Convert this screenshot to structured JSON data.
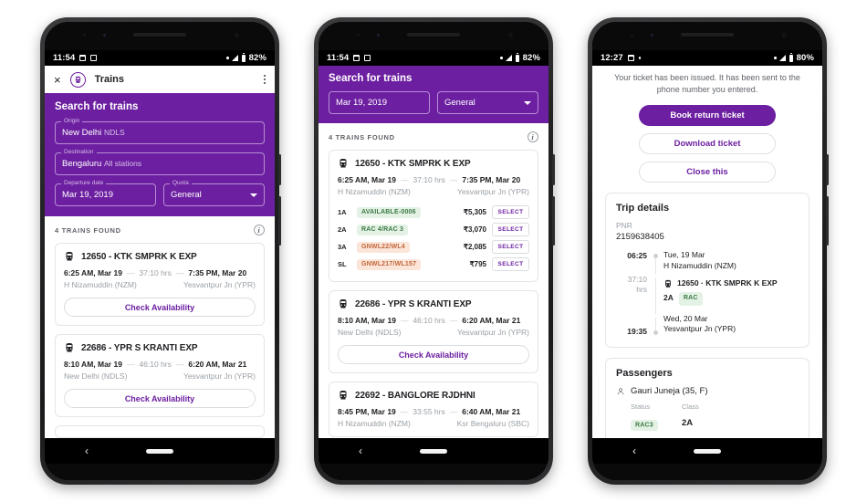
{
  "phone1": {
    "status_bar": {
      "time": "11:54",
      "battery": "82%"
    },
    "appbar": {
      "close_label": "×",
      "title": "Trains"
    },
    "search": {
      "heading": "Search for trains",
      "origin_label": "Origin",
      "origin_value": "New Delhi",
      "origin_sub": "NDLS",
      "destination_label": "Destination",
      "destination_value": "Bengaluru",
      "destination_sub": "All stations",
      "date_label": "Departure date",
      "date_value": "Mar 19, 2019",
      "quota_label": "Quota",
      "quota_value": "General"
    },
    "results_count": "4 TRAINS FOUND",
    "trains": [
      {
        "name": "12650 - KTK SMPRK K EXP",
        "depart": "6:25 AM, Mar 19",
        "duration": "37:10 hrs",
        "arrive": "7:35 PM, Mar 20",
        "from": "H Nizamuddin (NZM)",
        "to": "Yesvantpur Jn (YPR)",
        "cta": "Check Availability"
      },
      {
        "name": "22686 - YPR S KRANTI EXP",
        "depart": "8:10 AM, Mar 19",
        "duration": "46:10 hrs",
        "arrive": "6:20 AM, Mar 21",
        "from": "New Delhi (NDLS)",
        "to": "Yesvantpur Jn (YPR)",
        "cta": "Check Availability"
      }
    ]
  },
  "phone2": {
    "status_bar": {
      "time": "11:54",
      "battery": "82%"
    },
    "search": {
      "heading": "Search for trains",
      "date_value": "Mar 19, 2019",
      "quota_value": "General"
    },
    "results_count": "4 TRAINS FOUND",
    "train_expanded": {
      "name": "12650 - KTK SMPRK K EXP",
      "depart": "6:25 AM, Mar 19",
      "duration": "37:10 hrs",
      "arrive": "7:35 PM, Mar 20",
      "from": "H Nizamuddin (NZM)",
      "to": "Yesvantpur Jn (YPR)",
      "select_label": "SELECT",
      "fares": [
        {
          "class": "1A",
          "status": "AVAILABLE-0006",
          "status_type": "ok",
          "price": "₹5,305"
        },
        {
          "class": "2A",
          "status": "RAC 4/RAC 3",
          "status_type": "ok",
          "price": "₹3,070"
        },
        {
          "class": "3A",
          "status": "GNWL22/WL4",
          "status_type": "wl",
          "price": "₹2,085"
        },
        {
          "class": "SL",
          "status": "GNWL217/WL157",
          "status_type": "wl",
          "price": "₹795"
        }
      ]
    },
    "trains": [
      {
        "name": "22686 - YPR S KRANTI EXP",
        "depart": "8:10 AM, Mar 19",
        "duration": "46:10 hrs",
        "arrive": "6:20 AM, Mar 21",
        "from": "New Delhi (NDLS)",
        "to": "Yesvantpur Jn (YPR)",
        "cta": "Check Availability"
      },
      {
        "name": "22692 - BANGLORE RJDHNI",
        "depart": "8:45 PM, Mar 19",
        "duration": "33:55 hrs",
        "arrive": "6:40 AM, Mar 21",
        "from": "H Nizamuddin (NZM)",
        "to": "Ksr Bengaluru (SBC)"
      }
    ]
  },
  "phone3": {
    "status_bar": {
      "time": "12:27",
      "battery": "80%"
    },
    "confirmation": "Your ticket has been issued. It has been sent to the phone number you entered.",
    "actions": {
      "primary": "Book return ticket",
      "secondary": "Download ticket",
      "tertiary": "Close this"
    },
    "trip": {
      "heading": "Trip details",
      "pnr_label": "PNR",
      "pnr_value": "2159638405",
      "depart_time": "06:25",
      "depart_date": "Tue, 19 Mar",
      "depart_station": "H Nizamuddin (NZM)",
      "duration": "37:10",
      "duration_unit": "hrs",
      "train": "12650 · KTK SMPRK K EXP",
      "class": "2A",
      "class_status": "RAC",
      "arrive_date": "Wed, 20 Mar",
      "arrive_time": "19:35",
      "arrive_station": "Yesvantpur Jn (YPR)"
    },
    "passengers": {
      "heading": "Passengers",
      "name": "Gauri Juneja (35, F)",
      "status_label": "Status",
      "class_label": "Class",
      "status_value": "RAC3",
      "class_value": "2A"
    }
  },
  "colors": {
    "accent": "#6c1fa0",
    "badge_ok_bg": "#e3f2e5",
    "badge_ok_fg": "#3c7a44",
    "badge_wl_bg": "#fbe4d8",
    "badge_wl_fg": "#c2673a"
  }
}
